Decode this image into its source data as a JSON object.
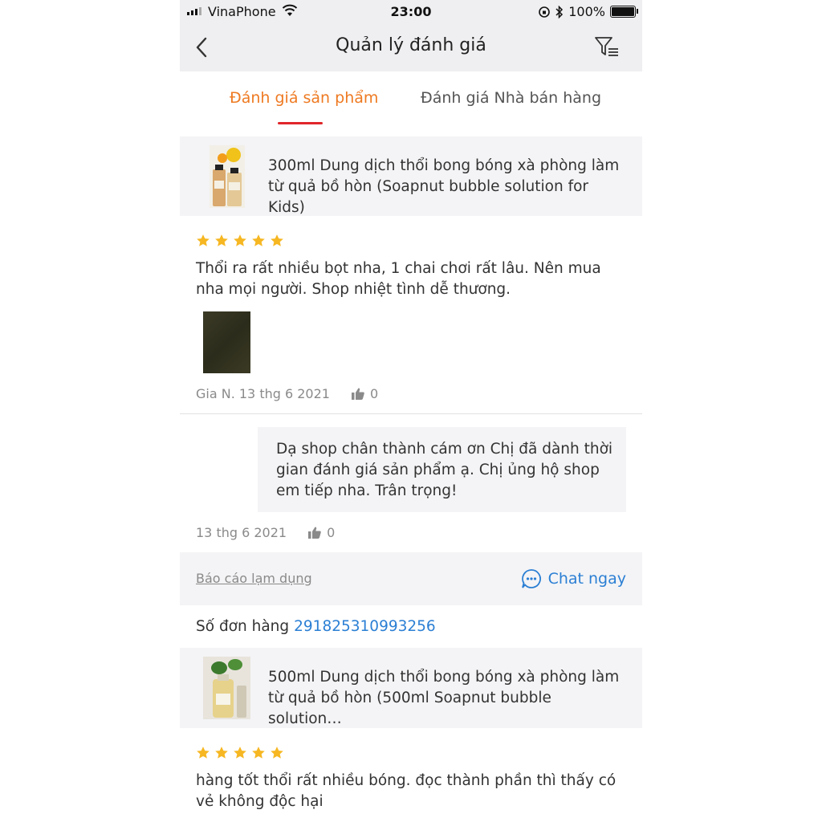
{
  "status_bar": {
    "carrier": "VinaPhone",
    "time": "23:00",
    "battery": "100%"
  },
  "nav": {
    "title": "Quản lý đánh giá"
  },
  "tabs": [
    {
      "label": "Đánh giá sản phẩm",
      "active": true
    },
    {
      "label": "Đánh giá Nhà bán hàng",
      "active": false
    }
  ],
  "reviews": [
    {
      "product_name": "300ml Dung dịch thổi bong bóng xà phòng làm từ quả bồ hòn (Soapnut bubble solution for Kids)",
      "stars": 5,
      "text": "Thổi ra rất nhiều bọt nha, 1 chai chơi rất lâu. Nên mua nha mọi người. Shop nhiệt tình dễ thương.",
      "author_date": "Gia N. 13 thg 6 2021",
      "likes": "0",
      "reply": {
        "text": "Dạ shop chân thành cám ơn Chị đã dành thời gian đánh giá sản phẩm ạ. Chị ủng hộ shop em tiếp nha. Trân trọng!",
        "date": "13 thg 6 2021",
        "likes": "0"
      },
      "report_label": "Báo cáo lạm dụng",
      "chat_label": "Chat ngay"
    },
    {
      "order_label": "Số đơn hàng",
      "order_number": "291825310993256",
      "product_name": "500ml Dung dịch thổi bong bóng xà phòng làm từ quả bồ hòn (500ml Soapnut bubble solution…",
      "stars": 5,
      "text": "hàng tốt thổi rất nhiều bóng. đọc thành phần thì thấy có vẻ không độc hại"
    }
  ],
  "colors": {
    "accent": "#ee7a22",
    "tab_indicator": "#e0262a",
    "link": "#2b7fd4",
    "star": "#f6b722"
  }
}
